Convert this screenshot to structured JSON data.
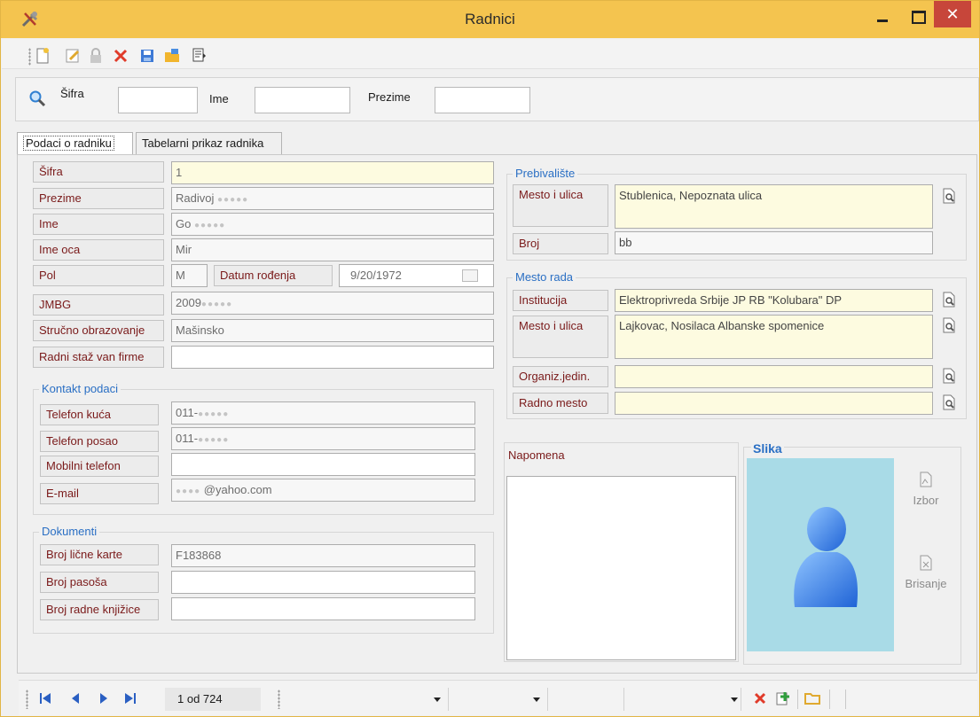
{
  "window": {
    "title": "Radnici",
    "close_glyph": "✕"
  },
  "search": {
    "sifra_label": "Šifra",
    "ime_label": "Ime",
    "prezime_label": "Prezime"
  },
  "tabs": [
    {
      "label": "Podaci o radniku"
    },
    {
      "label": "Tabelarni prikaz radnika"
    }
  ],
  "basic": {
    "sifra_label": "Šifra",
    "sifra_value": "1",
    "prezime_label": "Prezime",
    "prezime_value": "Radivoj",
    "ime_label": "Ime",
    "ime_value": "Go",
    "ime_oca_label": "Ime oca",
    "ime_oca_value": "Mir",
    "pol_label": "Pol",
    "pol_value": "M",
    "datum_label": "Datum rođenja",
    "datum_value": "9/20/1972",
    "jmbg_label": "JMBG",
    "jmbg_value": "2009",
    "obrazovanje_label": "Stručno obrazovanje",
    "obrazovanje_value": "Mašinsko",
    "staz_label": "Radni staž van firme",
    "staz_value": ""
  },
  "kontakt": {
    "title": "Kontakt podaci",
    "telefon_kuca_label": "Telefon kuća",
    "telefon_kuca_value": "011-",
    "telefon_posao_label": "Telefon posao",
    "telefon_posao_value": "011-",
    "mobilni_label": "Mobilni telefon",
    "mobilni_value": "",
    "email_label": "E-mail",
    "email_value": "@yahoo.com"
  },
  "dokumenti": {
    "title": "Dokumenti",
    "licna_label": "Broj lične karte",
    "licna_value": "F183868",
    "pasos_label": "Broj pasoša",
    "pasos_value": "",
    "knjizica_label": "Broj radne knjižice",
    "knjizica_value": ""
  },
  "prebivaliste": {
    "title": "Prebivalište",
    "mesto_label": "Mesto i ulica",
    "mesto_value": "Stublenica, Nepoznata ulica",
    "broj_label": "Broj",
    "broj_value": "bb"
  },
  "mesto_rada": {
    "title": "Mesto rada",
    "institucija_label": "Institucija",
    "institucija_value": "Elektroprivreda Srbije JP RB \"Kolubara\" DP",
    "mesto_label": "Mesto i ulica",
    "mesto_value": "Lajkovac, Nosilaca Albanske spomenice",
    "org_label": "Organiz.jedin.",
    "org_value": "",
    "radno_label": "Radno mesto",
    "radno_value": ""
  },
  "napomena": {
    "label": "Napomena",
    "value": ""
  },
  "slika": {
    "title": "Slika",
    "izbor_label": "Izbor",
    "brisanje_label": "Brisanje"
  },
  "status": {
    "pager": "1 od 724"
  },
  "colors": {
    "titlebar": "#f4c44f",
    "close_button": "#c7463a",
    "label_text": "#7a1a1a",
    "group_title": "#2a6fc4",
    "required_field": "#fdfbe0",
    "photo_bg": "#a9dbe7"
  },
  "icons": {
    "app": "tools-icon",
    "toolbar": [
      "new-document-icon",
      "edit-icon",
      "lock-icon",
      "delete-icon",
      "save-icon",
      "folder-icon",
      "print-icon"
    ],
    "search": "magnifier-icon",
    "lookup": "lookup-icon",
    "nav": [
      "first-record-icon",
      "previous-record-icon",
      "next-record-icon",
      "last-record-icon"
    ],
    "statusbar": [
      "delete-icon",
      "add-icon",
      "open-folder-icon"
    ]
  }
}
